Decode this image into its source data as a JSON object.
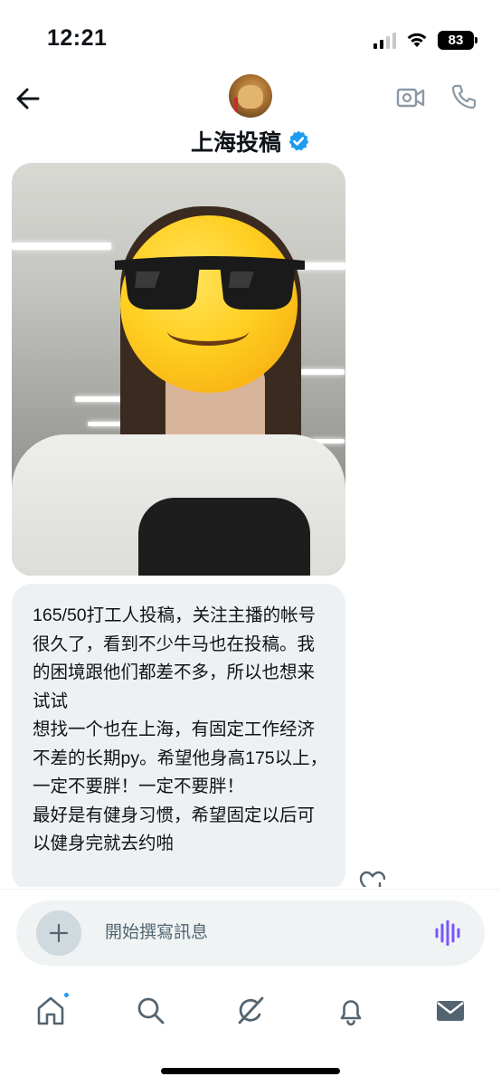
{
  "status_bar": {
    "time": "12:21",
    "battery": "83",
    "icons": [
      "signal-icon",
      "wifi-icon",
      "battery-icon"
    ]
  },
  "header": {
    "contact_name": "上海投稿",
    "verified": true,
    "icons": [
      "back-arrow-icon",
      "video-call-icon",
      "phone-icon",
      "verified-badge-icon"
    ]
  },
  "messages": [
    {
      "type": "image",
      "description_icon": "sunglasses-emoji-icon"
    },
    {
      "type": "text",
      "text": "165/50打工人投稿，关注主播的帐号很久了，看到不少牛马也在投稿。我的困境跟他们都差不多，所以也想来试试\n想找一个也在上海，有固定工作经济不差的长期py。希望他身高175以上，一定不要胖！一定不要胖！\n最好是有健身习惯，希望固定以后可以健身完就去约啪"
    }
  ],
  "composer": {
    "placeholder": "開始撰寫訊息",
    "value": ""
  },
  "tab_bar": {
    "items": [
      "home-icon",
      "search-icon",
      "grok-icon",
      "notifications-icon",
      "messages-icon"
    ],
    "home_has_badge": true
  },
  "colors": {
    "accent": "#1d9bf0",
    "voice_accent": "#7856ff",
    "bubble": "#eef1f3",
    "text": "#0f1419"
  }
}
